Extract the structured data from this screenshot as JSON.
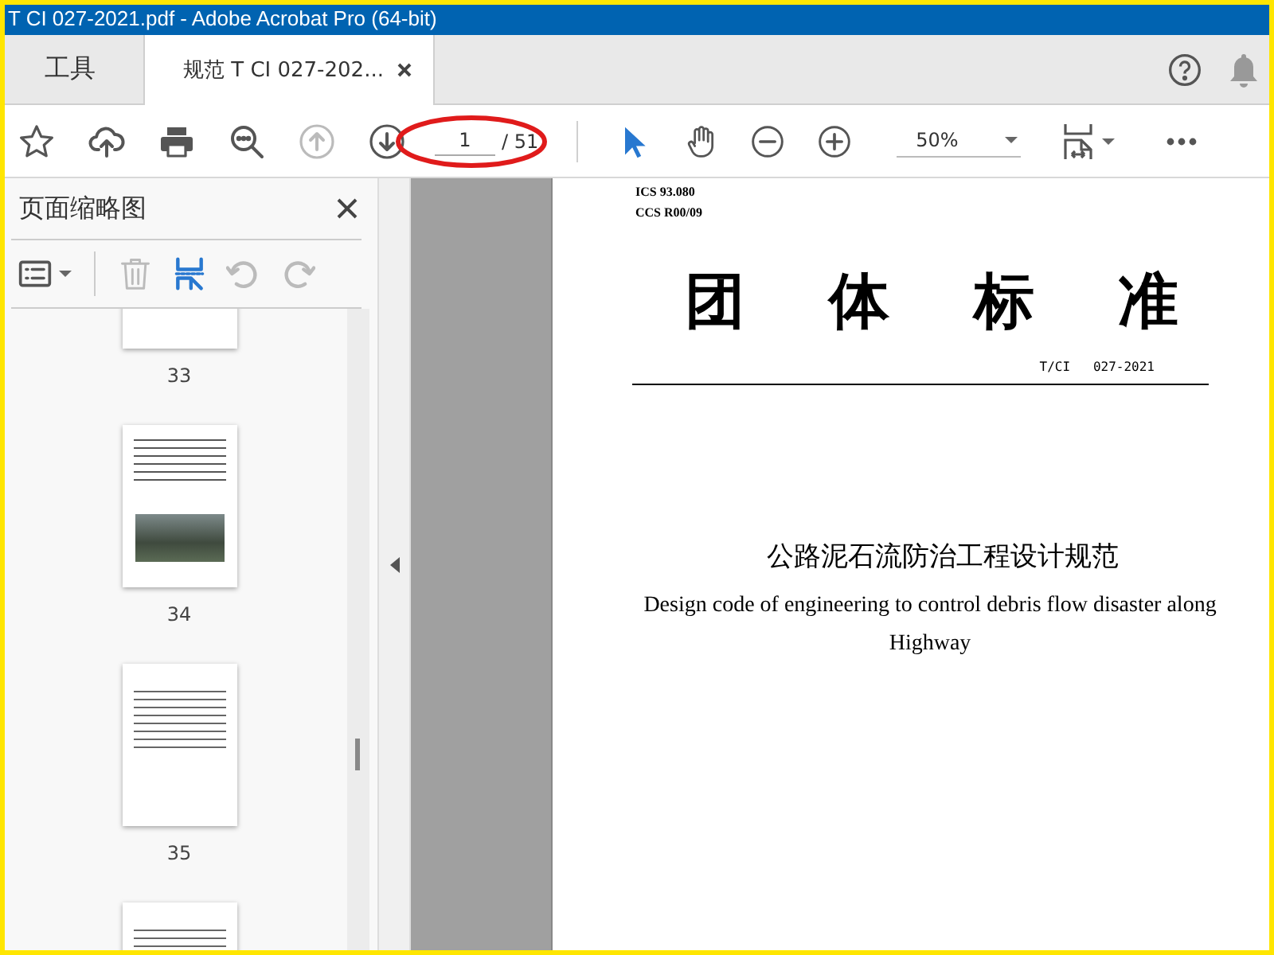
{
  "window": {
    "title": "T CI 027-2021.pdf - Adobe Acrobat Pro (64-bit)"
  },
  "tabs": [
    {
      "label": "工具",
      "selected": false
    },
    {
      "label": "规范 T CI 027-202...",
      "selected": true
    }
  ],
  "toolbar": {
    "buttons": [
      {
        "kind": "star",
        "disabled": false
      },
      {
        "kind": "upload",
        "disabled": false
      },
      {
        "kind": "print",
        "disabled": false
      },
      {
        "kind": "find",
        "disabled": false
      },
      {
        "kind": "prev-page",
        "disabled": true
      },
      {
        "kind": "next-page",
        "disabled": false
      }
    ],
    "page_input": {
      "value": "1",
      "highlighted": true
    },
    "page_total": "/ 51",
    "tools": [
      {
        "kind": "select",
        "selected": true
      },
      {
        "kind": "hand",
        "selected": false
      },
      {
        "kind": "zoom-out",
        "selected": false
      },
      {
        "kind": "zoom-in",
        "selected": false
      }
    ],
    "zoom": {
      "value": "50%"
    }
  },
  "sidebar": {
    "title": "页面缩略图",
    "tools": [
      {
        "kind": "options",
        "disabled": false
      },
      {
        "kind": "delete",
        "disabled": true
      },
      {
        "kind": "insert",
        "disabled": false
      },
      {
        "kind": "undo",
        "disabled": true
      },
      {
        "kind": "redo",
        "disabled": true
      }
    ],
    "thumbnails": [
      {
        "label": "33",
        "kind": "text"
      },
      {
        "label": "34",
        "kind": "photo"
      },
      {
        "label": "35",
        "kind": "text"
      },
      {
        "kind": "text"
      }
    ]
  },
  "document": {
    "codes": [
      "ICS 93.080",
      "CCS R00/09"
    ],
    "heading_chars": [
      "团",
      "体",
      "标",
      "准"
    ],
    "number": "T/CI   027-2021",
    "title_cn": "公路泥石流防治工程设计规范",
    "title_en": "Design code of engineering to control debris flow disaster along Highway"
  }
}
